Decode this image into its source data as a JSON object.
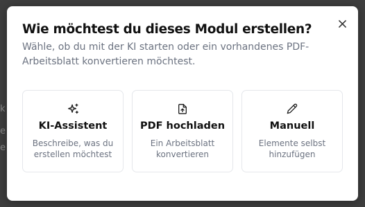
{
  "backdrop": {
    "fragment_1": "k",
    "fragment_2": "e",
    "fragment_3": "e"
  },
  "dialog": {
    "title": "Wie möchtest du dieses Modul erstellen?",
    "subtitle": "Wähle, ob du mit der KI starten oder ein vorhandenes PDF-Arbeitsblatt konvertieren möchtest.",
    "close_icon": "close-icon"
  },
  "options": [
    {
      "icon": "sparkles-icon",
      "title": "KI-Assistent",
      "description": "Beschreibe, was du erstellen möchtest"
    },
    {
      "icon": "file-upload-icon",
      "title": "PDF hochladen",
      "description": "Ein Arbeitsblatt konvertieren"
    },
    {
      "icon": "pencil-icon",
      "title": "Manuell",
      "description": "Elemente selbst hinzufügen"
    }
  ],
  "colors": {
    "overlay": "#3e3e3e",
    "dialog_background": "#ffffff",
    "title": "#111111",
    "muted_text": "#6b7280",
    "card_border": "#e5e7eb"
  }
}
